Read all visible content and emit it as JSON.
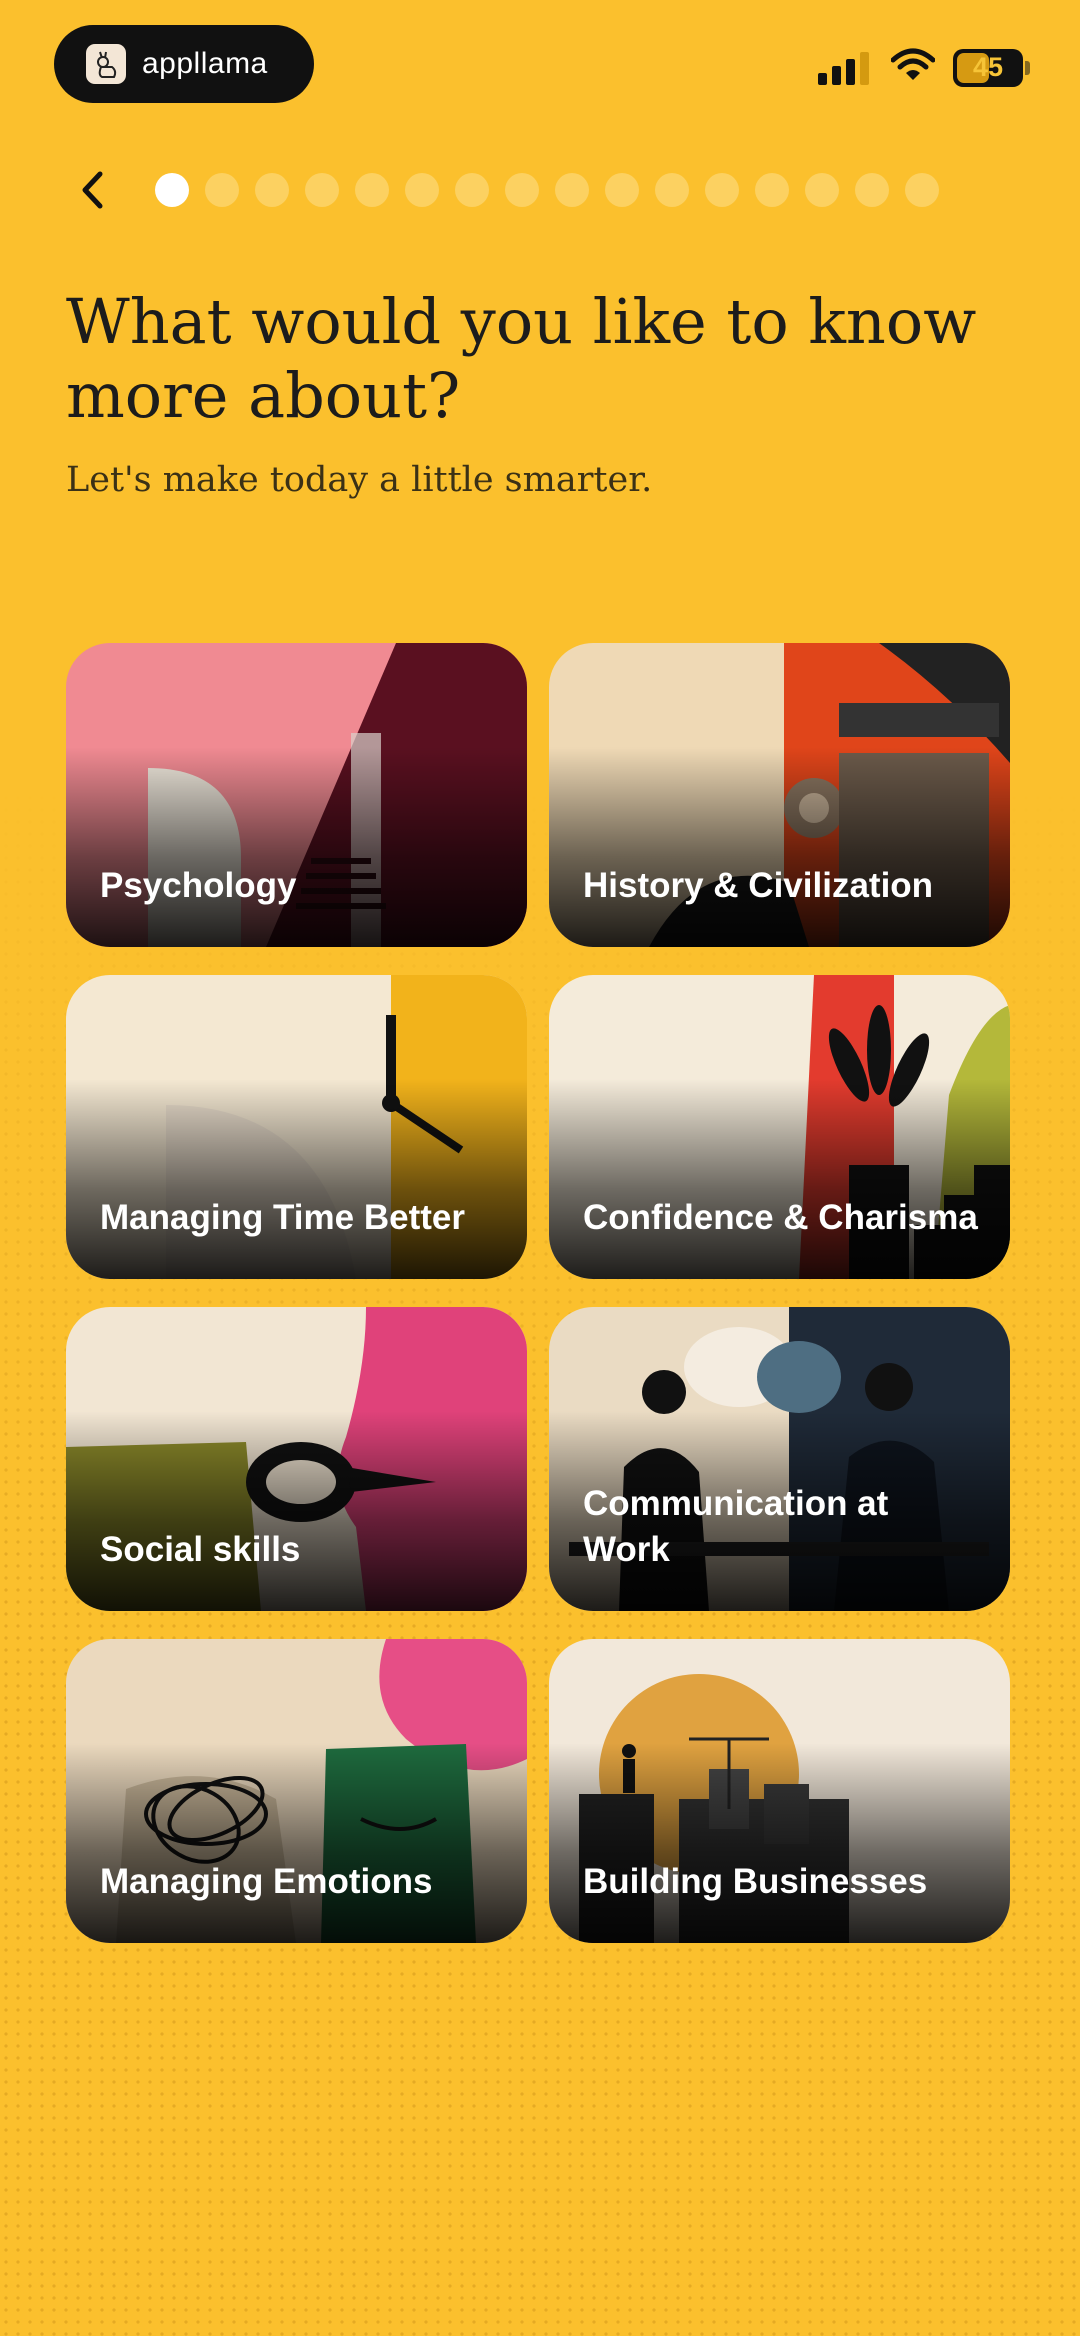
{
  "status_bar": {
    "app_name": "appllama",
    "battery": "45"
  },
  "progress": {
    "total_steps": 16,
    "current_step": 1
  },
  "header": {
    "title": "What would you like to know more about?",
    "subtitle": "Let's make today a little smarter."
  },
  "topics": [
    {
      "label": "Psychology"
    },
    {
      "label": "History & Civilization"
    },
    {
      "label": "Managing Time Better"
    },
    {
      "label": "Confidence & Charisma"
    },
    {
      "label": "Social skills"
    },
    {
      "label": "Communication at Work"
    },
    {
      "label": "Managing Emotions"
    },
    {
      "label": "Building Businesses"
    }
  ],
  "colors": {
    "background": "#FBC02D",
    "pill": "#111111",
    "dot_inactive": "#FCD161",
    "dot_active": "#FFFFFF"
  }
}
